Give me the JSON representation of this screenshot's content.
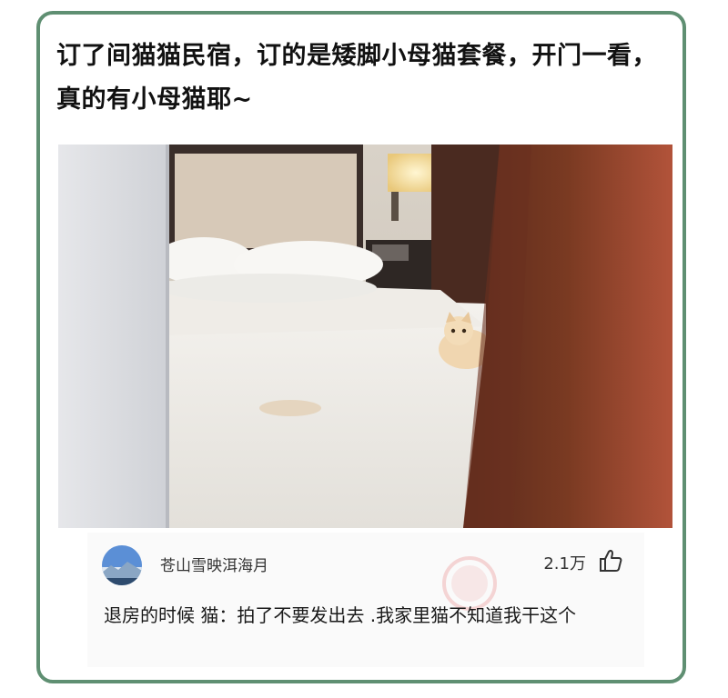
{
  "post": {
    "title": "订了间猫猫民宿，订的是矮脚小母猫套餐，开门一看，真的有小母猫耶~"
  },
  "comment": {
    "username": "苍山雪映洱海月",
    "likes": "2.1万",
    "text": "退房的时候  猫：拍了不要发出去  .我家里猫不知道我干这个",
    "icons": {
      "avatar": "avatar-sky-landscape",
      "like": "thumbs-up-icon",
      "watermark": "shenping-stamp-icon"
    }
  },
  "colors": {
    "card_border": "#5f8f72",
    "title_text": "#111111",
    "comment_bg": "#fafafa",
    "stamp": "#e05050"
  }
}
